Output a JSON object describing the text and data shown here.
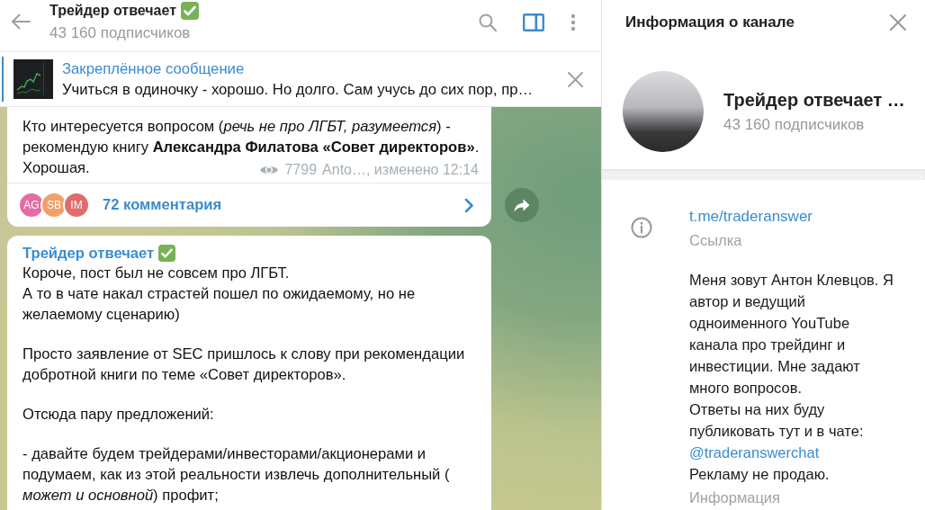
{
  "chat_header": {
    "title": "Трейдер отвечает",
    "check_emoji": true,
    "subscribers": "43 160 подписчиков",
    "sidebar_toggle": {
      "selected": true
    }
  },
  "pinned_message": {
    "title": "Закреплённое сообщение",
    "preview": "Учиться в одиночку - хорошо. Но долго. Сам учусь до сих пор, пр…"
  },
  "messages": [
    {
      "paragraphs": [
        [
          "Кто интересуется вопросом (*речь не про ЛГБТ, разумеется*) - рекомендую книгу **Александра Филатова «Совет директоров»**.",
          "Хорошая."
        ]
      ],
      "views": "7799",
      "signature": "Anto…, изменено 12:14",
      "comments": {
        "avatars": [
          {
            "initials": "AG",
            "color": "#e46da3"
          },
          {
            "initials": "SB",
            "color": "#f2a06a"
          },
          {
            "initials": "IM",
            "color": "#e06c6c"
          }
        ],
        "label": "72 комментария"
      }
    },
    {
      "sender": "Трейдер отвечает",
      "check_emoji": true,
      "paragraphs": [
        [
          "Короче, пост был не совсем про ЛГБТ.",
          "А то в чате накал страстей пошел по ожидаемому, но не желаемому сценарию)"
        ],
        [
          "Просто заявление от SEC пришлось к слову при рекомендации добротной книги по теме «Совет директоров»."
        ],
        [
          "Отсюда пару предложений:"
        ],
        [
          "- давайте будем трейдерами/инвесторами/акционерами и подумаем, как из этой реальности извлечь дополнительный ( *может и основной*) профит;"
        ]
      ]
    }
  ],
  "channel_info": {
    "title": "Информация о канале",
    "name": "Трейдер отвечает …",
    "subscribers": "43 160 подписчиков",
    "link": "t.me/traderanswer",
    "link_label": "Ссылка",
    "description": [
      {
        "kind": "text",
        "text": "Меня зовут Антон Клевцов. Я автор и ведущий одноименного YouTube канала про трейдинг и инвестиции. Мне задают много вопросов.\nОтветы на них буду публиковать тут и в чате: "
      },
      {
        "kind": "mention",
        "text": "@traderanswerchat"
      },
      {
        "kind": "text",
        "text": "\nРекламу не продаю."
      }
    ],
    "description_label": "Информация"
  }
}
